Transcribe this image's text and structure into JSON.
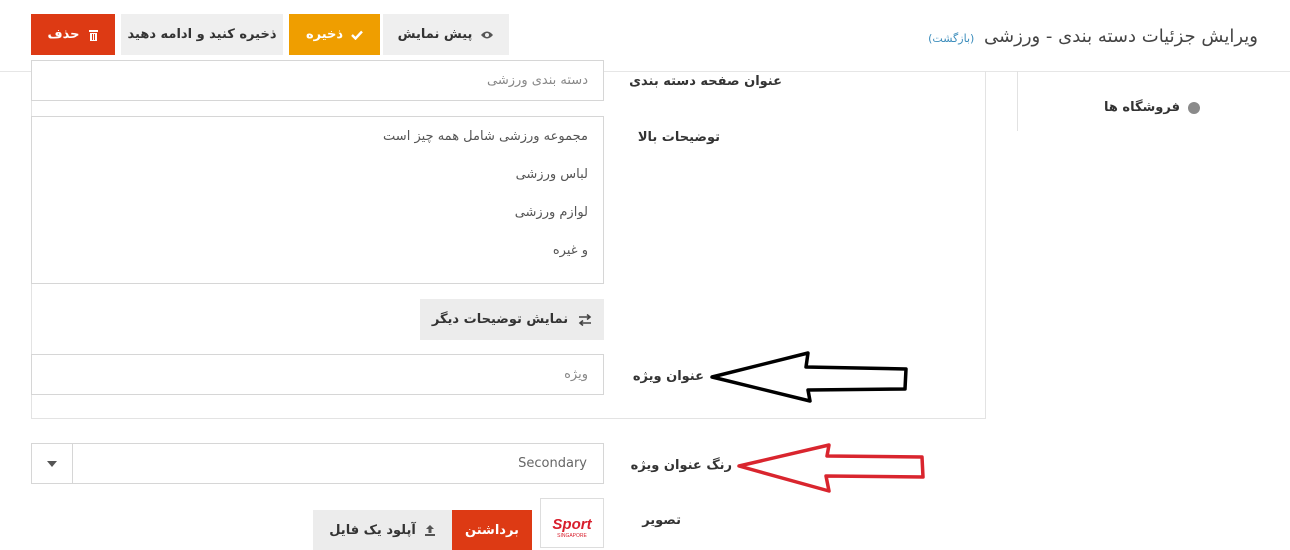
{
  "header": {
    "title": "ویرایش جزئیات دسته بندی - ورزشی",
    "back_link": "(بازگشت)"
  },
  "toolbar": {
    "delete_label": "حذف",
    "save_continue_label": "ذخیره کنید و ادامه دهید",
    "save_label": "ذخیره",
    "preview_label": "پیش نمایش"
  },
  "sidebar": {
    "stores_label": "فروشگاه ها"
  },
  "form": {
    "page_title_label": "عنوان صفحه دسته بندی",
    "page_title_value": "دسته بندی ورزشی",
    "top_description_label": "توضیحات بالا",
    "top_description_lines": [
      "مجموعه ورزشی شامل همه چیز است",
      "لباس ورزشی",
      "لوازم ورزشی",
      "و غیره"
    ],
    "more_descriptions_label": "نمایش توضیحات دیگر",
    "special_title_label": "عنوان ویژه",
    "special_title_placeholder": "ویژه",
    "special_title_color_label": "رنگ عنوان ویژه",
    "special_title_color_value": "Secondary",
    "image_label": "تصویر",
    "remove_label": "برداشتن",
    "upload_label": "آپلود یک فایل",
    "image_logo_text": "Sport",
    "image_logo_subtext": "SINGAPORE"
  },
  "colors": {
    "delete": "#dd3a14",
    "save": "#ef9e00",
    "link": "#3c8dbc",
    "annotation_black": "#000000",
    "annotation_red": "#d9252e"
  }
}
